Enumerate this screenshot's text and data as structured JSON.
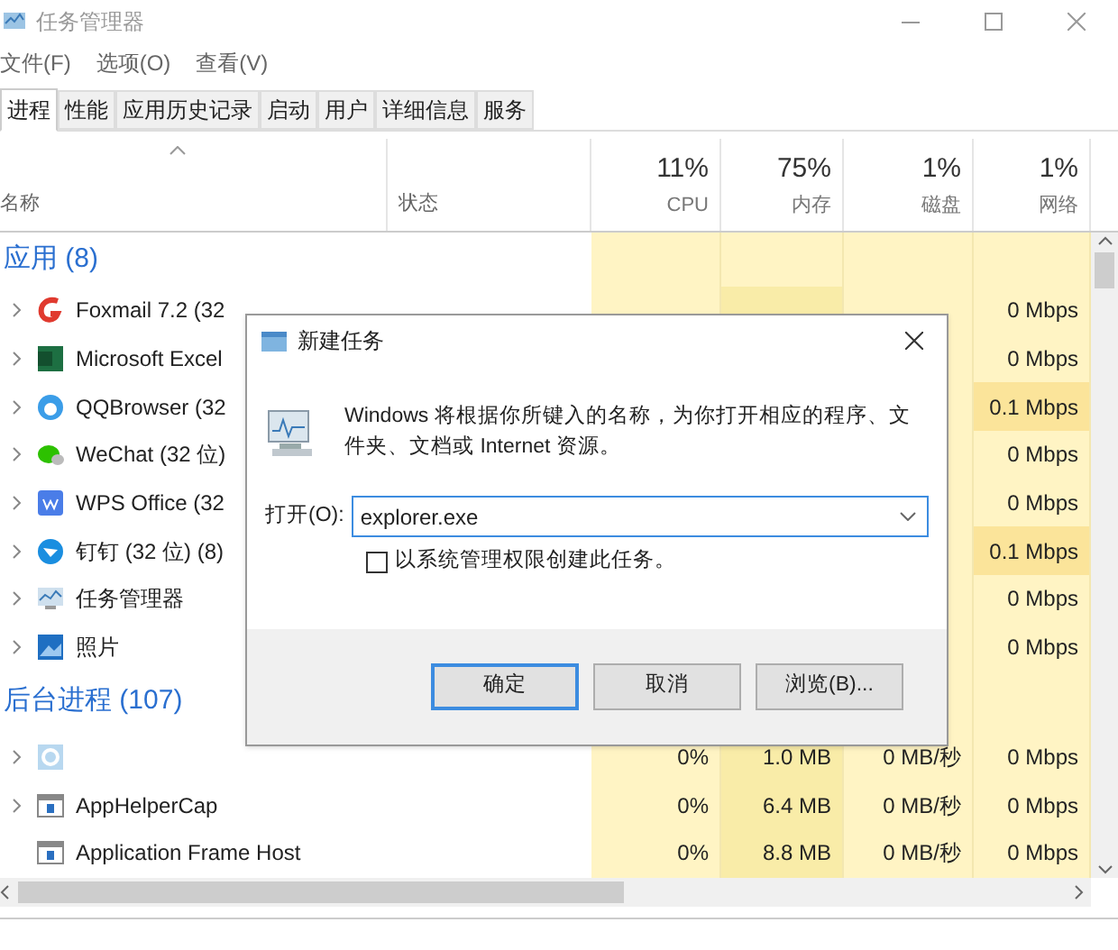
{
  "window": {
    "title": "任务管理器"
  },
  "menu": [
    "文件(F)",
    "选项(O)",
    "查看(V)"
  ],
  "tabs": [
    {
      "label": "进程",
      "selected": true
    },
    {
      "label": "性能",
      "selected": false
    },
    {
      "label": "应用历史记录",
      "selected": false
    },
    {
      "label": "启动",
      "selected": false
    },
    {
      "label": "用户",
      "selected": false
    },
    {
      "label": "详细信息",
      "selected": false
    },
    {
      "label": "服务",
      "selected": false
    }
  ],
  "columns": [
    {
      "label": "名称",
      "kind": "name"
    },
    {
      "label": "状态",
      "kind": "status"
    },
    {
      "label": "CPU",
      "usage": "11%",
      "kind": "stat"
    },
    {
      "label": "内存",
      "usage": "75%",
      "kind": "stat"
    },
    {
      "label": "磁盘",
      "usage": "1%",
      "kind": "stat"
    },
    {
      "label": "网络",
      "usage": "1%",
      "kind": "stat"
    }
  ],
  "groups": [
    {
      "title": "应用 (8)",
      "rows": [
        {
          "name": "Foxmail 7.2 (32",
          "expandable": true,
          "network": "0 Mbps",
          "high": false
        },
        {
          "name": "Microsoft Excel",
          "expandable": true,
          "network": "0 Mbps",
          "high": false
        },
        {
          "name": "QQBrowser (32",
          "expandable": true,
          "network": "0.1 Mbps",
          "high": true
        },
        {
          "name": "WeChat (32 位)",
          "expandable": true,
          "network": "0 Mbps",
          "high": false
        },
        {
          "name": "WPS Office (32",
          "expandable": true,
          "network": "0 Mbps",
          "high": false
        },
        {
          "name": "钉钉 (32 位) (8)",
          "expandable": true,
          "network": "0.1 Mbps",
          "high": true
        },
        {
          "name": "任务管理器",
          "expandable": true,
          "network": "0 Mbps",
          "high": false
        },
        {
          "name": "照片",
          "expandable": true,
          "network": "0 Mbps",
          "high": false
        }
      ]
    },
    {
      "title": "后台进程 (107)",
      "rows": [
        {
          "expandable": true,
          "cpu": "0%",
          "memory": "1.0 MB",
          "disk": "0 MB/秒",
          "network": "0 Mbps",
          "high": false
        },
        {
          "name": "AppHelperCap",
          "expandable": true,
          "cpu": "0%",
          "memory": "6.4 MB",
          "disk": "0 MB/秒",
          "network": "0 Mbps",
          "high": false
        },
        {
          "name": "Application Frame Host",
          "expandable": false,
          "cpu": "0%",
          "memory": "8.8 MB",
          "disk": "0 MB/秒",
          "network": "0 Mbps",
          "high": false
        }
      ]
    }
  ],
  "dialog": {
    "title": "新建任务",
    "message": "Windows 将根据你所键入的名称，为你打开相应的程序、文件夹、文档或 Internet 资源。",
    "open_label": "打开(O):",
    "value": "explorer.exe",
    "checkbox": {
      "label": "以系统管理权限创建此任务。",
      "checked": false
    },
    "buttons": [
      {
        "label": "确定",
        "default": true
      },
      {
        "label": "取消",
        "default": false
      },
      {
        "label": "浏览(B)...",
        "default": false
      }
    ]
  }
}
